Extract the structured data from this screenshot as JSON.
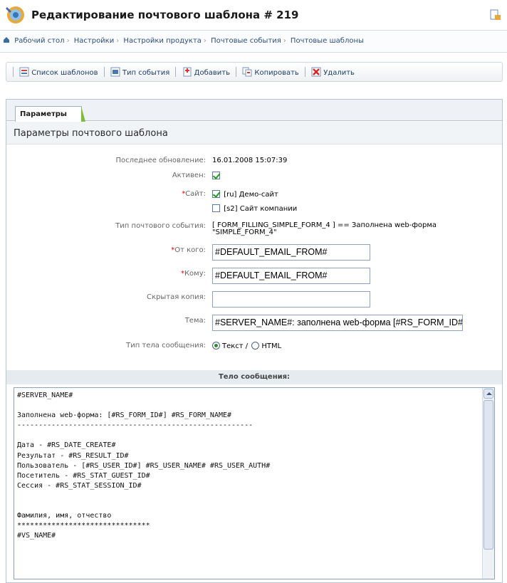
{
  "header": {
    "title": "Редактирование почтового шаблона # 219"
  },
  "breadcrumb": [
    "Рабочий стол",
    "Настройки",
    "Настройки продукта",
    "Почтовые события",
    "Почтовые шаблоны"
  ],
  "toolbar": {
    "list": "Список шаблонов",
    "event_type": "Тип события",
    "add": "Добавить",
    "copy": "Копировать",
    "delete": "Удалить"
  },
  "tabs": [
    {
      "label": "Параметры"
    }
  ],
  "section_title": "Параметры почтового шаблона",
  "form": {
    "last_update_label": "Последнее обновление:",
    "last_update_value": "16.01.2008 15:07:39",
    "active_label": "Активен:",
    "active_checked": true,
    "site_label": "Сайт:",
    "sites": [
      {
        "label": "[ru] Демо-сайт",
        "checked": true
      },
      {
        "label": "[s2] Сайт компании",
        "checked": false
      }
    ],
    "event_type_label": "Тип почтового события:",
    "event_type_value": "[ FORM_FILLING_SIMPLE_FORM_4 ] == Заполнена web-форма \"SIMPLE_FORM_4\"",
    "from_label": "От кого:",
    "from_value": "#DEFAULT_EMAIL_FROM#",
    "to_label": "Кому:",
    "to_value": "#DEFAULT_EMAIL_FROM#",
    "bcc_label": "Скрытая копия:",
    "bcc_value": "",
    "subject_label": "Тема:",
    "subject_value": "#SERVER_NAME#: заполнена web-форма [#RS_FORM_ID#] #RS_FORM_NAME#",
    "body_type_label": "Тип тела сообщения:",
    "body_type_text": "Текст /",
    "body_type_html": "HTML",
    "body_type_selected": "text"
  },
  "message_body": {
    "heading": "Тело сообщения:",
    "text": "#SERVER_NAME#\n\nЗаполнена web-форма: [#RS_FORM_ID#] #RS_FORM_NAME#\n-------------------------------------------------------\n\nДата - #RS_DATE_CREATE#\nРезультат - #RS_RESULT_ID#\nПользователь - [#RS_USER_ID#] #RS_USER_NAME# #RS_USER_AUTH#\nПосетитель - #RS_STAT_GUEST_ID#\nСессия - #RS_STAT_SESSION_ID#\n\n\nФамилия, имя, отчество\n*******************************\n#VS_NAME#"
  },
  "colors": {
    "accent": "#2b4d7a",
    "required": "#e00000",
    "tab_marker": "#7bbf3a"
  }
}
